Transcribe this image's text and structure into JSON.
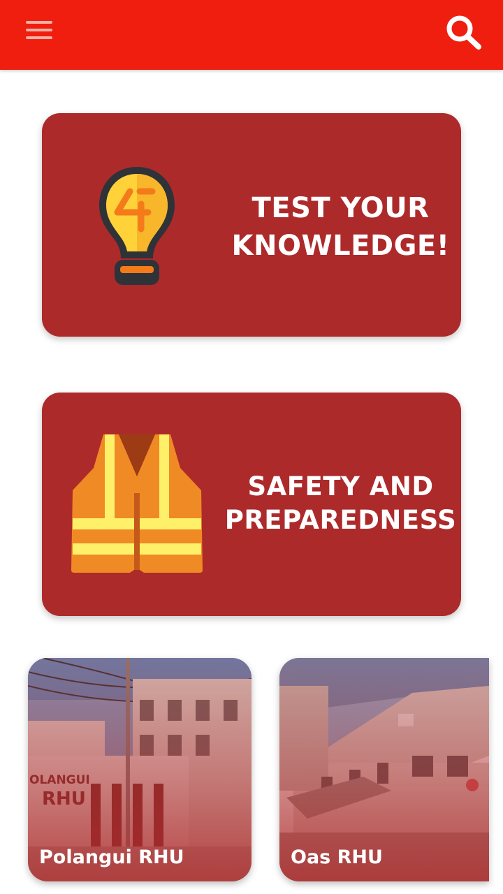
{
  "appbar": {
    "menu_icon": "hamburger-menu-icon",
    "search_icon": "search-icon",
    "color": "#f01e0e"
  },
  "cards": {
    "quiz": {
      "title": "TEST YOUR\nKNOWLEDGE!",
      "icon": "lightbulb-icon"
    },
    "safety": {
      "title": "SAFETY AND\nPREPAREDNESS",
      "icon": "safety-vest-icon"
    },
    "color": "#ad2a2b"
  },
  "places": [
    {
      "label": "Polangui RHU",
      "sign_text": "OLANGUI RHU"
    },
    {
      "label": "Oas RHU"
    }
  ]
}
